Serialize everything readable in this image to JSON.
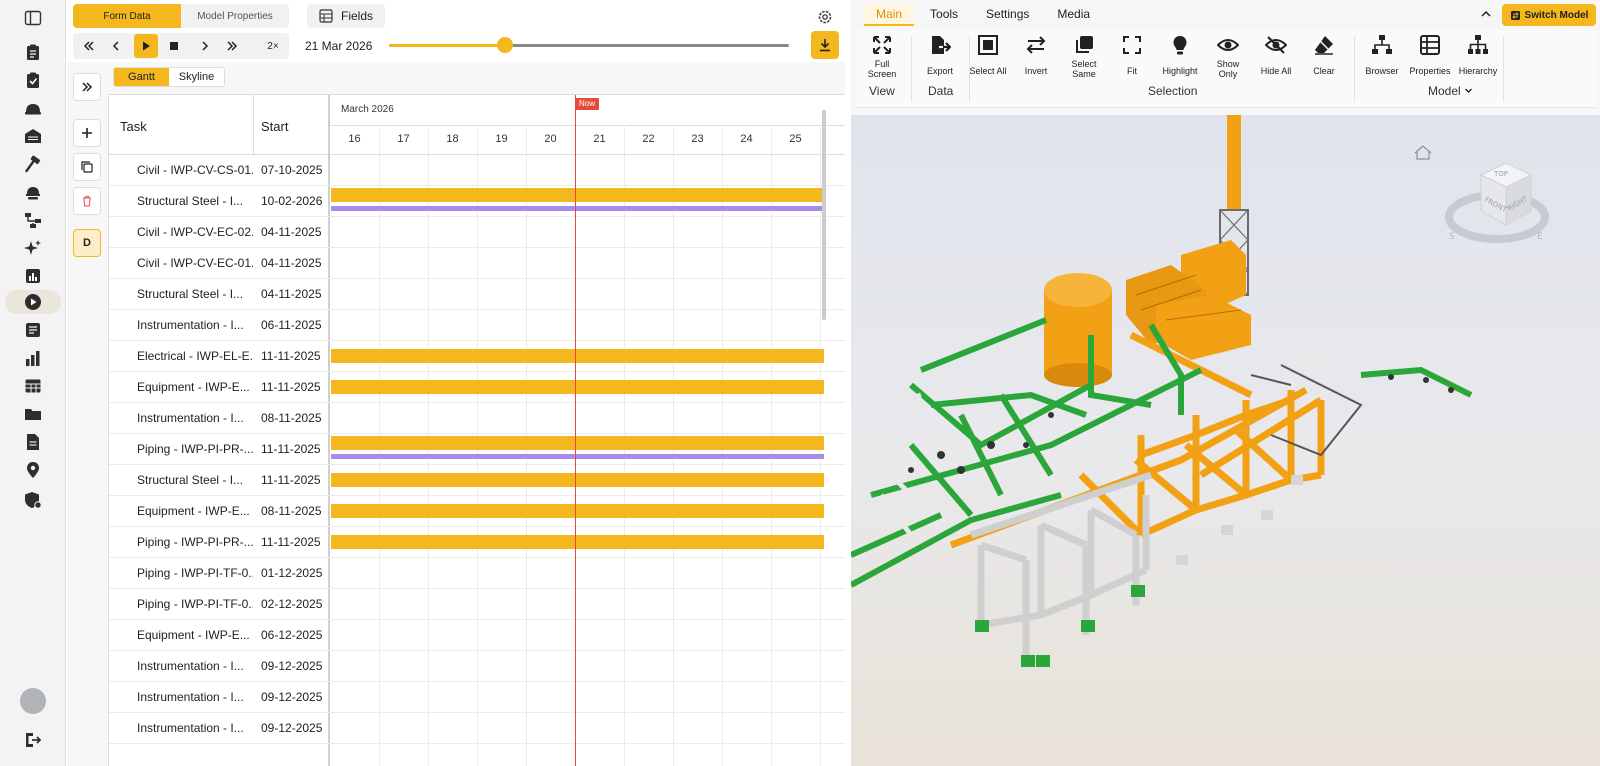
{
  "toolbar": {
    "form_tab": "Form Data",
    "model_tab": "Model Properties",
    "fields_label": "Fields",
    "speed_label": "2×",
    "date_label": "21 Mar 2026",
    "timeline_progress": 0.29
  },
  "gantt": {
    "view_tabs": [
      "Gantt",
      "Skyline"
    ],
    "side_tool_d": "D",
    "col_task": "Task",
    "col_start": "Start",
    "month": "March 2026",
    "days": [
      "16",
      "17",
      "18",
      "19",
      "20",
      "21",
      "22",
      "23",
      "24",
      "25"
    ],
    "now_label": "Now",
    "rows": [
      {
        "task": "Civil - IWP-CV-CS-01...",
        "start": "07-10-2025",
        "bar": false,
        "bar2": false
      },
      {
        "task": "Structural Steel - I...",
        "start": "10-02-2026",
        "bar": true,
        "bar2": true
      },
      {
        "task": "Civil - IWP-CV-EC-02...",
        "start": "04-11-2025",
        "bar": false,
        "bar2": false
      },
      {
        "task": "Civil - IWP-CV-EC-01...",
        "start": "04-11-2025",
        "bar": false,
        "bar2": false
      },
      {
        "task": "Structural Steel - I...",
        "start": "04-11-2025",
        "bar": false,
        "bar2": false
      },
      {
        "task": "Instrumentation - I...",
        "start": "06-11-2025",
        "bar": false,
        "bar2": false
      },
      {
        "task": "Electrical - IWP-EL-E...",
        "start": "11-11-2025",
        "bar": true,
        "bar2": false
      },
      {
        "task": "Equipment - IWP-E...",
        "start": "11-11-2025",
        "bar": true,
        "bar2": false
      },
      {
        "task": "Instrumentation - I...",
        "start": "08-11-2025",
        "bar": false,
        "bar2": false
      },
      {
        "task": "Piping - IWP-PI-PR-...",
        "start": "11-11-2025",
        "bar": true,
        "bar2": true
      },
      {
        "task": "Structural Steel - I...",
        "start": "11-11-2025",
        "bar": true,
        "bar2": false
      },
      {
        "task": "Equipment - IWP-E...",
        "start": "08-11-2025",
        "bar": true,
        "bar2": false
      },
      {
        "task": "Piping - IWP-PI-PR-...",
        "start": "11-11-2025",
        "bar": true,
        "bar2": false
      },
      {
        "task": "Piping - IWP-PI-TF-0...",
        "start": "01-12-2025",
        "bar": false,
        "bar2": false
      },
      {
        "task": "Piping - IWP-PI-TF-0...",
        "start": "02-12-2025",
        "bar": false,
        "bar2": false
      },
      {
        "task": "Equipment - IWP-E...",
        "start": "06-12-2025",
        "bar": false,
        "bar2": false
      },
      {
        "task": "Instrumentation - I...",
        "start": "09-12-2025",
        "bar": false,
        "bar2": false
      },
      {
        "task": "Instrumentation - I...",
        "start": "09-12-2025",
        "bar": false,
        "bar2": false
      },
      {
        "task": "Instrumentation - I...",
        "start": "09-12-2025",
        "bar": false,
        "bar2": false
      }
    ]
  },
  "ribbon": {
    "tabs": [
      "Main",
      "Tools",
      "Settings",
      "Media"
    ],
    "switch_model": "Switch Model",
    "buttons": {
      "full_screen": [
        "Full",
        "Screen"
      ],
      "export": "Export",
      "select_all": "Select All",
      "invert": "Invert",
      "select_same": [
        "Select",
        "Same"
      ],
      "fit": "Fit",
      "highlight": "Highlight",
      "show_only": [
        "Show",
        "Only"
      ],
      "hide_all": "Hide All",
      "clear": "Clear",
      "browser": "Browser",
      "properties": "Properties",
      "hierarchy": "Hierarchy"
    },
    "groups": {
      "view": "View",
      "data": "Data",
      "selection": "Selection",
      "model": "Model"
    }
  },
  "viewport": {
    "cube_top": "TOP",
    "cube_front": "FRONT",
    "cube_right": "RIGHT",
    "compass_s": "S",
    "compass_e": "E"
  },
  "colors": {
    "accent": "#f4b71d",
    "now": "#e44b3b",
    "secondary_bar": "#a98ce6",
    "pipe_green": "#2aa63a",
    "steel_orange": "#f2a114"
  }
}
